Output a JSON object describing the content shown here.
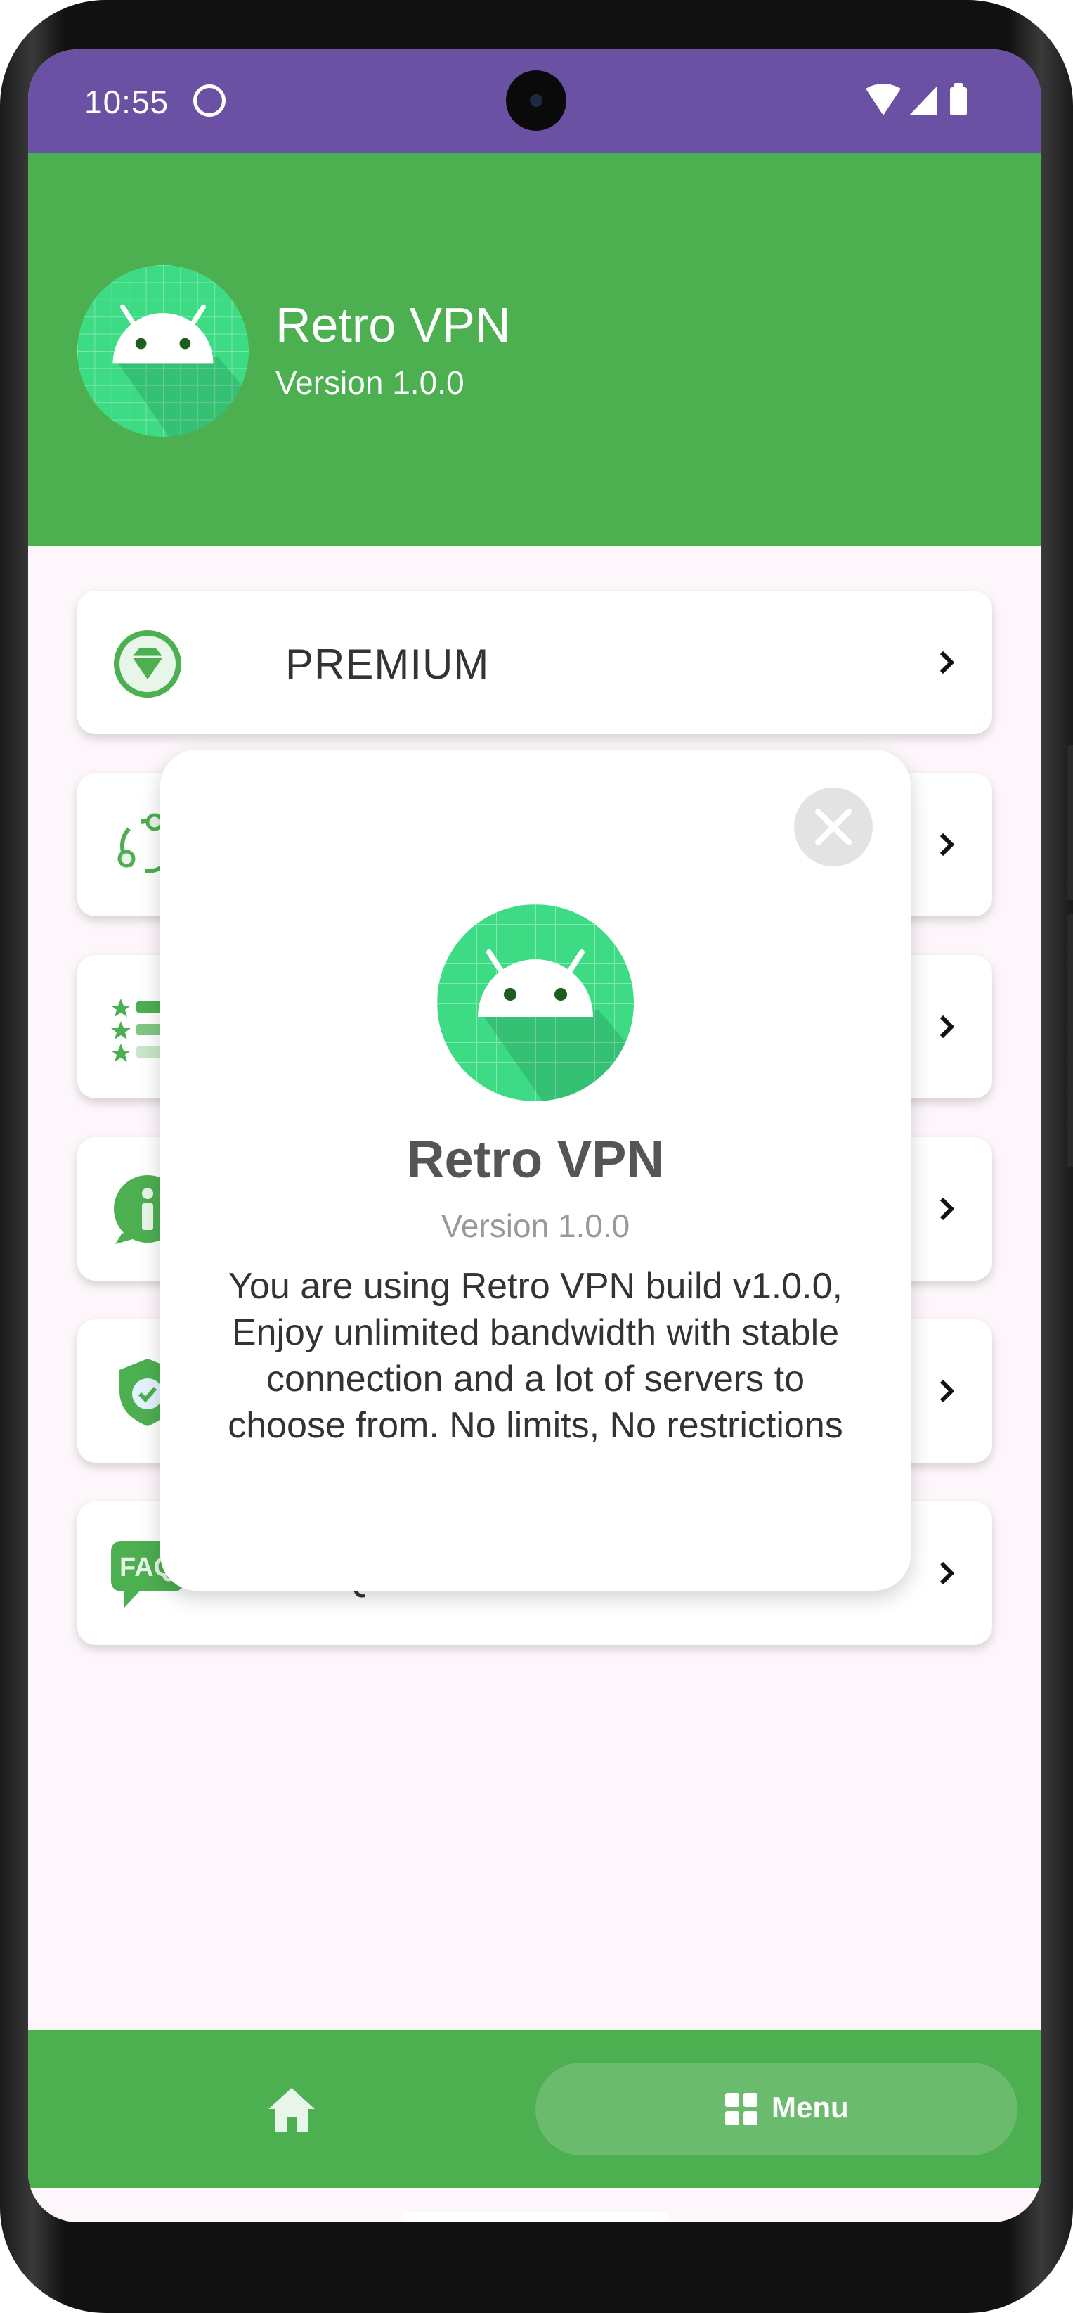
{
  "status_bar": {
    "time": "10:55",
    "background": "#6a51a3",
    "icons": [
      "cat-notification-icon",
      "wifi-icon",
      "cellular-signal-icon",
      "battery-icon"
    ]
  },
  "header": {
    "background": "#4caf50",
    "app_name": "Retro VPN",
    "version": "Version 1.0.0"
  },
  "menu": {
    "items": [
      {
        "label": "PREMIUM",
        "icon": "premium-gem-icon"
      },
      {
        "label": "",
        "icon": "share-icon"
      },
      {
        "label": "",
        "icon": "rate-stars-icon"
      },
      {
        "label": "",
        "icon": "info-icon"
      },
      {
        "label": "",
        "icon": "privacy-shield-icon"
      },
      {
        "label": "FAQs",
        "icon": "faq-icon"
      }
    ]
  },
  "bottom_nav": {
    "home_icon": "home-icon",
    "menu_label": "Menu",
    "menu_icon": "grid-menu-icon"
  },
  "dialog": {
    "app_name": "Retro VPN",
    "version": "Version 1.0.0",
    "description": "You are using Retro VPN build v1.0.0, Enjoy unlimited bandwidth with stable connection and a lot of servers to choose from. No limits, No restrictions",
    "close_icon": "close-icon"
  },
  "colors": {
    "accent_green": "#4caf50",
    "status_purple": "#6a51a3",
    "logo_green": "#3ddc84"
  }
}
